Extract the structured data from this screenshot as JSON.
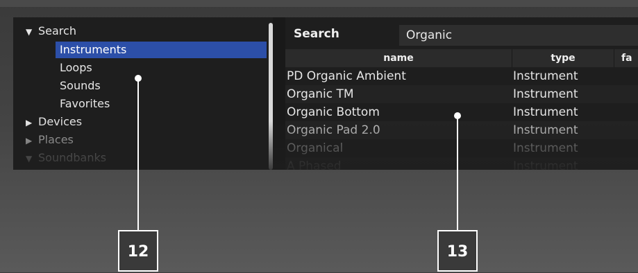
{
  "tree": {
    "search": {
      "arrow": "▼",
      "label": "Search"
    },
    "search_children": [
      "Instruments",
      "Loops",
      "Sounds",
      "Favorites"
    ],
    "devices": {
      "arrow": "▶",
      "label": "Devices"
    },
    "places": {
      "arrow": "▶",
      "label": "Places"
    },
    "soundbanks": {
      "arrow": "▼",
      "label": "Soundbanks"
    }
  },
  "results": {
    "search_label": "Search",
    "search_value": "Organic",
    "columns": {
      "name": "name",
      "type": "type",
      "fav": "fa"
    },
    "rows": [
      {
        "name": "PD Organic Ambient",
        "type": "Instrument"
      },
      {
        "name": "Organic TM",
        "type": "Instrument"
      },
      {
        "name": "Organic Bottom",
        "type": "Instrument"
      },
      {
        "name": "Organic Pad 2.0",
        "type": "Instrument"
      },
      {
        "name": "Organical",
        "type": "Instrument"
      },
      {
        "name": "A Phased",
        "type": "Instrument"
      }
    ]
  },
  "callouts": {
    "left": "12",
    "right": "13"
  },
  "colors": {
    "selection": "#2c4fa8",
    "panel": "#1e1e1e"
  }
}
